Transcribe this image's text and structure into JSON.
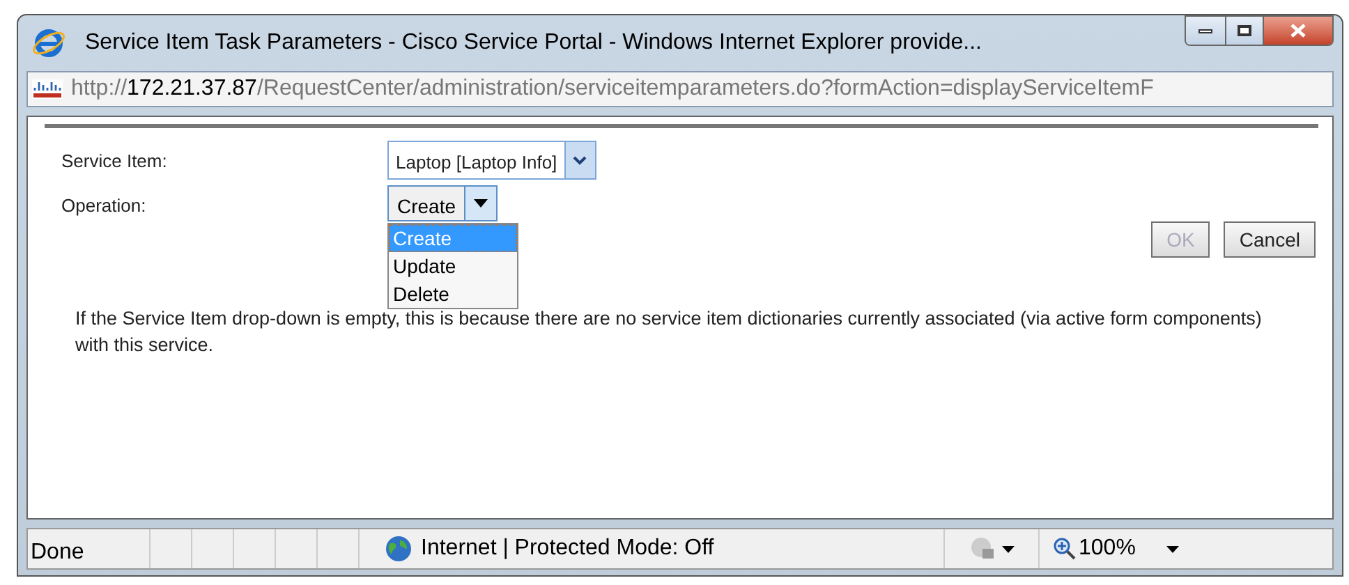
{
  "window": {
    "title": "Service Item Task Parameters - Cisco Service Portal - Windows Internet Explorer provide..."
  },
  "address_bar": {
    "scheme": "http://",
    "host": "172.21.37.87",
    "path": "/RequestCenter/administration/serviceitemparameters.do?formAction=displayServiceItemF"
  },
  "form": {
    "fields": [
      {
        "label": "Service Item:",
        "value": "Laptop [Laptop Info]",
        "kind": "select"
      },
      {
        "label": "Operation:",
        "value": "Create",
        "kind": "open-select",
        "options": [
          {
            "label": "Create",
            "selected": true
          },
          {
            "label": "Update",
            "selected": false
          },
          {
            "label": "Delete",
            "selected": false
          }
        ]
      }
    ],
    "buttons": [
      {
        "label": "OK",
        "disabled": true
      },
      {
        "label": "Cancel",
        "disabled": false
      }
    ],
    "note": "If the Service Item drop-down is empty, this is because there are no service item dictionaries currently associated (via active form components) with this service."
  },
  "status_bar": {
    "status": "Done",
    "zone": "Internet | Protected Mode: Off",
    "zoom": "100%"
  }
}
